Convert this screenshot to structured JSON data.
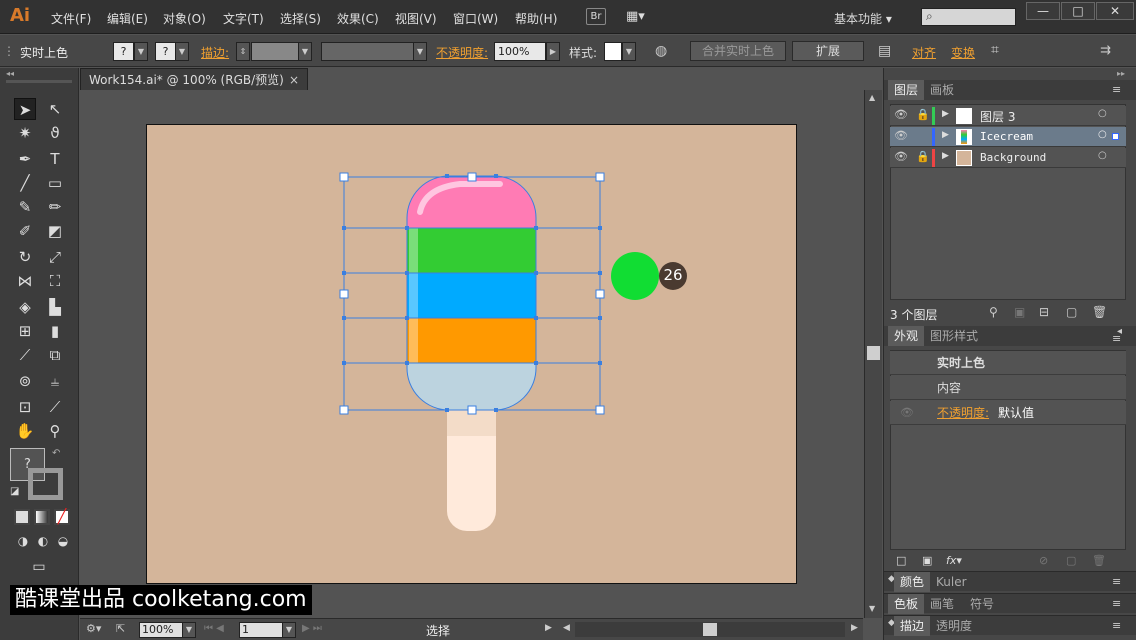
{
  "app": {
    "logo": "Ai"
  },
  "menu": {
    "items": [
      "文件(F)",
      "编辑(E)",
      "对象(O)",
      "文字(T)",
      "选择(S)",
      "效果(C)",
      "视图(V)",
      "窗口(W)",
      "帮助(H)"
    ],
    "bridge": "Br",
    "workspace": "基本功能",
    "window_buttons": [
      "—",
      "□",
      "✕"
    ]
  },
  "control": {
    "mode_label": "实时上色",
    "fill_box": "?",
    "stroke_box": "?",
    "stroke_label": "描边:",
    "opacity_label": "不透明度:",
    "opacity_value": "100%",
    "style_label": "样式:",
    "merge_button": "合并实时上色",
    "expand_button": "扩展",
    "align_label": "对齐",
    "transform_label": "变换"
  },
  "document": {
    "tab_title": "Work154.ai* @ 100% (RGB/预览)",
    "tab_close": "×"
  },
  "canvas": {
    "badge_number": "26",
    "artboard_color": "#d4b59a",
    "stripe_colors": [
      "#ff7bb4",
      "#33cc33",
      "#00aaff",
      "#ff9900",
      "#bcd3df"
    ],
    "stick_color": "#ffeadb",
    "swatch_color": "#11dd33"
  },
  "status": {
    "zoom": "100%",
    "page": "1",
    "mode": "选择"
  },
  "layers_panel": {
    "tabs": [
      "图层",
      "画板"
    ],
    "rows": [
      {
        "name": "图层 3",
        "color": "#33cc55"
      },
      {
        "name": "Icecream",
        "color": "#3366ff"
      },
      {
        "name": "Background",
        "color": "#ee4444"
      }
    ],
    "count": "3 个图层"
  },
  "appearance_panel": {
    "tabs": [
      "外观",
      "图形样式"
    ],
    "title": "实时上色",
    "content_label": "内容",
    "opacity_label": "不透明度:",
    "opacity_value": "默认值"
  },
  "collapsed_panels": {
    "row1": [
      "颜色",
      "Kuler"
    ],
    "row2": [
      "色板",
      "画笔",
      "符号"
    ],
    "row3": [
      "描边",
      "透明度"
    ]
  },
  "watermark": "酷课堂出品 coolketang.com"
}
